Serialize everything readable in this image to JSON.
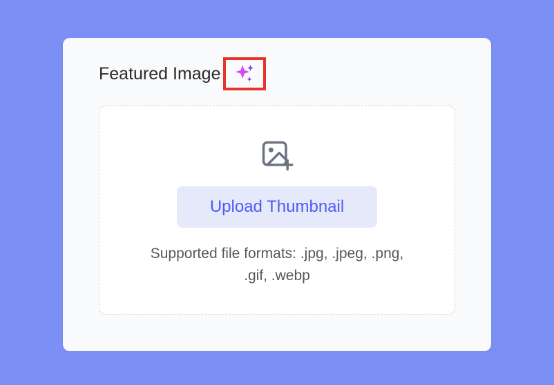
{
  "section": {
    "title": "Featured Image"
  },
  "dropzone": {
    "upload_label": "Upload Thumbnail",
    "supported_formats": "Supported file formats: .jpg, .jpeg, .png, .gif, .webp"
  },
  "highlight": {
    "color": "#e8332c"
  }
}
